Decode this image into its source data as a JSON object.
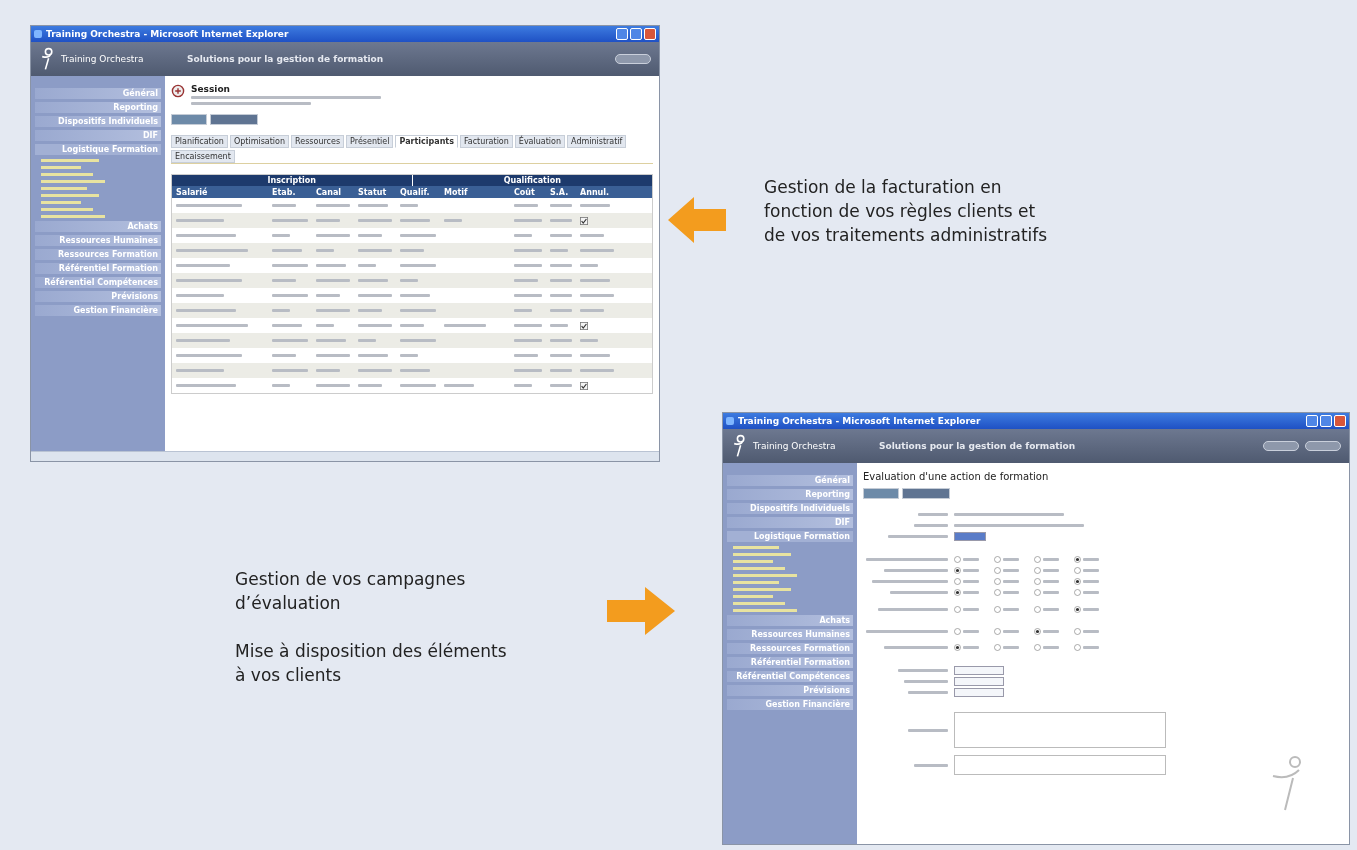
{
  "billing_screen": {
    "window_title": "Training Orchestra - Microsoft Internet Explorer",
    "app_name": "Training Orchestra",
    "tagline": "Solutions pour la gestion de formation",
    "sidebar": [
      {
        "label": "Général",
        "expanded": false
      },
      {
        "label": "Reporting",
        "expanded": false
      },
      {
        "label": "Dispositifs Individuels",
        "expanded": false
      },
      {
        "label": "DIF",
        "expanded": false
      },
      {
        "label": "Logistique Formation",
        "expanded": true,
        "children": [
          {
            "kind": "link"
          },
          {
            "kind": "link"
          },
          {
            "kind": "link"
          },
          {
            "kind": "link"
          },
          {
            "kind": "link"
          },
          {
            "kind": "link"
          },
          {
            "kind": "link"
          },
          {
            "kind": "link"
          },
          {
            "kind": "link"
          }
        ]
      },
      {
        "label": "Achats",
        "expanded": false
      },
      {
        "label": "Ressources Humaines",
        "expanded": false
      },
      {
        "label": "Ressources Formation",
        "expanded": false
      },
      {
        "label": "Référentiel Formation",
        "expanded": false
      },
      {
        "label": "Référentiel Compétences",
        "expanded": false
      },
      {
        "label": "Prévisions",
        "expanded": false
      },
      {
        "label": "Gestion Financière",
        "expanded": false
      }
    ],
    "page_title": "Session",
    "tabs": [
      {
        "label": "Planification",
        "selected": false
      },
      {
        "label": "Optimisation",
        "selected": false
      },
      {
        "label": "Ressources",
        "selected": false
      },
      {
        "label": "Présentiel",
        "selected": false
      },
      {
        "label": "Participants",
        "selected": true
      },
      {
        "label": "Facturation",
        "selected": false
      },
      {
        "label": "Évaluation",
        "selected": false
      },
      {
        "label": "Administratif",
        "selected": false
      },
      {
        "label": "Encaissement",
        "selected": false
      }
    ],
    "table": {
      "groups": [
        "Inscription",
        "Qualification"
      ],
      "columns": [
        "Salarié",
        "Etab.",
        "Canal",
        "Statut",
        "Qualif.",
        "Motif",
        "Coût",
        "S.A.",
        "Annul."
      ],
      "rows": [
        {
          "checkbox": false
        },
        {
          "checkbox": true
        },
        {
          "checkbox": false
        },
        {
          "checkbox": false
        },
        {
          "checkbox": false
        },
        {
          "checkbox": false
        },
        {
          "checkbox": false
        },
        {
          "checkbox": false
        },
        {
          "checkbox": true
        },
        {
          "checkbox": false
        },
        {
          "checkbox": false
        },
        {
          "checkbox": false
        },
        {
          "checkbox": true
        }
      ]
    }
  },
  "billing_caption": [
    "Gestion de la facturation en",
    "fonction de vos règles clients et",
    "de vos traitements administratifs"
  ],
  "evaluation_caption": [
    "Gestion de vos campagnes",
    "d’évaluation"
  ],
  "sharing_caption": [
    "Mise à disposition des éléments",
    "à vos clients"
  ],
  "evaluation_screen": {
    "window_title": "Training Orchestra - Microsoft Internet Explorer",
    "app_name": "Training Orchestra",
    "tagline": "Solutions pour la gestion de formation",
    "sidebar": [
      {
        "label": "Général",
        "expanded": false
      },
      {
        "label": "Reporting",
        "expanded": false
      },
      {
        "label": "Dispositifs Individuels",
        "expanded": false
      },
      {
        "label": "DIF",
        "expanded": false
      },
      {
        "label": "Logistique Formation",
        "expanded": true,
        "children": [
          {
            "kind": "link"
          },
          {
            "kind": "link"
          },
          {
            "kind": "link"
          },
          {
            "kind": "link"
          },
          {
            "kind": "link"
          },
          {
            "kind": "link"
          },
          {
            "kind": "link"
          },
          {
            "kind": "link"
          },
          {
            "kind": "link"
          },
          {
            "kind": "link"
          }
        ]
      },
      {
        "label": "Achats",
        "expanded": false
      },
      {
        "label": "Ressources Humaines",
        "expanded": false
      },
      {
        "label": "Ressources Formation",
        "expanded": false
      },
      {
        "label": "Référentiel Formation",
        "expanded": false
      },
      {
        "label": "Référentiel Compétences",
        "expanded": false
      },
      {
        "label": "Prévisions",
        "expanded": false
      },
      {
        "label": "Gestion Financière",
        "expanded": false
      }
    ],
    "page_title": "Evaluation d'une action de formation",
    "questions": [
      {
        "choices": [
          {
            "selected": false
          },
          {
            "selected": false
          },
          {
            "selected": false
          },
          {
            "selected": true
          }
        ]
      },
      {
        "choices": [
          {
            "selected": true
          },
          {
            "selected": false
          },
          {
            "selected": false
          },
          {
            "selected": false
          }
        ]
      },
      {
        "choices": [
          {
            "selected": false
          },
          {
            "selected": false
          },
          {
            "selected": false
          },
          {
            "selected": true
          }
        ]
      },
      {
        "choices": [
          {
            "selected": true
          },
          {
            "selected": false
          },
          {
            "selected": false
          },
          {
            "selected": false
          }
        ]
      },
      {
        "choices": [
          {
            "selected": false
          },
          {
            "selected": false
          },
          {
            "selected": false
          },
          {
            "selected": true
          }
        ]
      },
      {
        "choices": [
          {
            "selected": false
          },
          {
            "selected": false
          },
          {
            "selected": true
          },
          {
            "selected": false
          }
        ]
      },
      {
        "choices": [
          {
            "selected": true
          },
          {
            "selected": false
          },
          {
            "selected": false
          },
          {
            "selected": false
          }
        ]
      }
    ]
  }
}
